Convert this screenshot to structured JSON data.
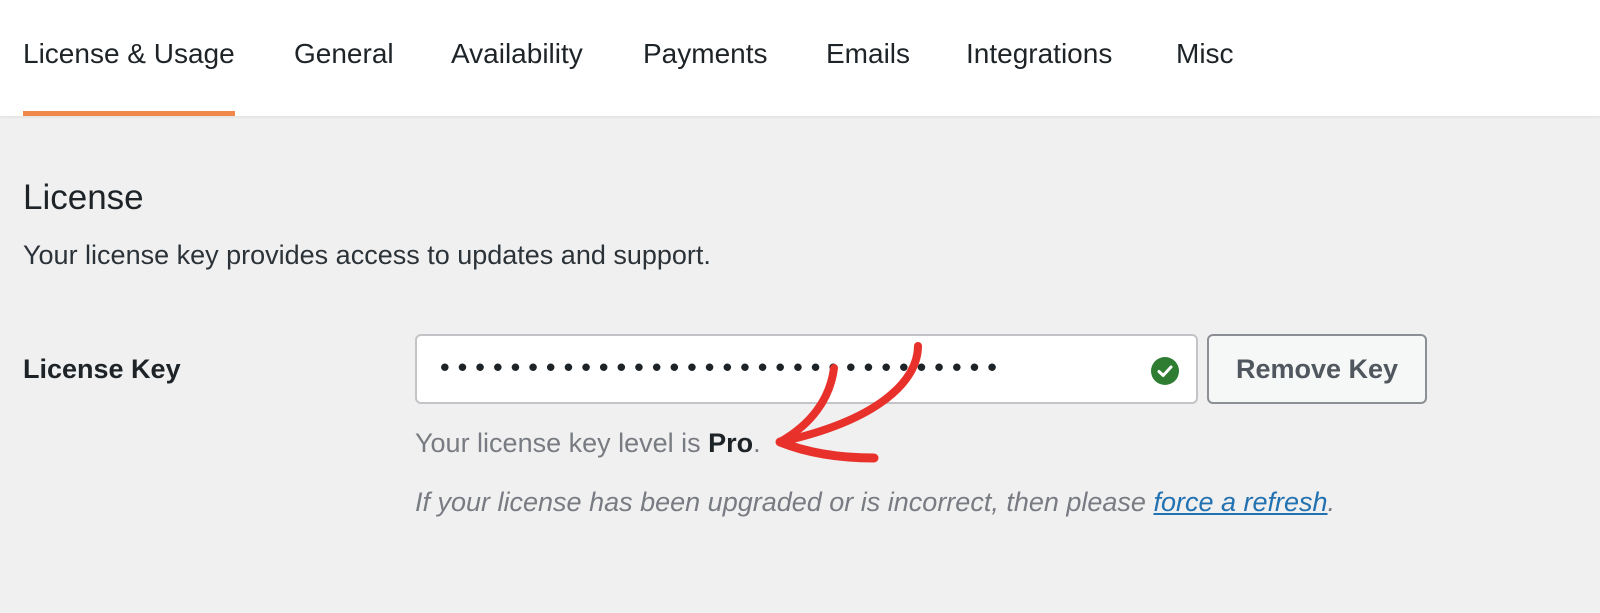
{
  "tabs": [
    {
      "label": "License & Usage",
      "active": true
    },
    {
      "label": "General"
    },
    {
      "label": "Availability"
    },
    {
      "label": "Payments"
    },
    {
      "label": "Emails"
    },
    {
      "label": "Integrations"
    },
    {
      "label": "Misc"
    }
  ],
  "section": {
    "title": "License",
    "description": "Your license key provides access to updates and support."
  },
  "license_key": {
    "label": "License Key",
    "masked_value": "••••••••••••••••••••••••••••••••",
    "status_icon": "check-circle-icon",
    "remove_button": "Remove Key"
  },
  "level": {
    "prefix": "Your license key level is ",
    "value": "Pro",
    "suffix": "."
  },
  "help": {
    "text": "If your license has been upgraded or is incorrect, then please ",
    "link": "force a refresh",
    "suffix": "."
  },
  "colors": {
    "accent": "#f0884a",
    "success": "#2e7d32",
    "link": "#2271b1",
    "annotation": "#e8312a"
  }
}
